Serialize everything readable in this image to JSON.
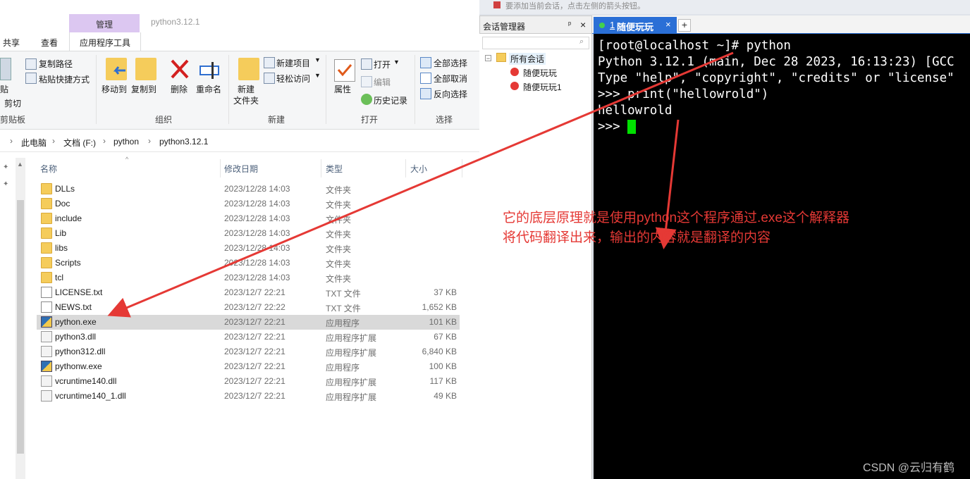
{
  "explorer": {
    "ribbon_tabs": {
      "share": "共享",
      "view": "查看",
      "ctx_group": "管理",
      "ctx_tab": "应用程序工具",
      "window_title": "python3.12.1"
    },
    "clipboard": {
      "paste": "贴",
      "cut": "剪切",
      "copy_path": "复制路径",
      "paste_shortcut": "粘贴快捷方式",
      "label": "剪贴板"
    },
    "organize": {
      "move_to": "移动到",
      "copy_to": "复制到",
      "delete": "删除",
      "rename": "重命名",
      "label": "组织"
    },
    "new": {
      "new_folder_1": "新建",
      "new_folder_2": "文件夹",
      "new_item": "新建项目",
      "easy_access": "轻松访问",
      "label": "新建"
    },
    "open": {
      "properties": "属性",
      "open": "打开",
      "edit": "编辑",
      "history": "历史记录",
      "label": "打开"
    },
    "select": {
      "select_all": "全部选择",
      "select_none": "全部取消",
      "invert": "反向选择",
      "label": "选择"
    },
    "breadcrumb": [
      "此电脑",
      "文档 (F:)",
      "python",
      "python3.12.1"
    ],
    "columns": {
      "name": "名称",
      "date": "修改日期",
      "type": "类型",
      "size": "大小"
    },
    "files": [
      {
        "name": "DLLs",
        "date": "2023/12/28 14:03",
        "type": "文件夹",
        "size": "",
        "icon": "folder"
      },
      {
        "name": "Doc",
        "date": "2023/12/28 14:03",
        "type": "文件夹",
        "size": "",
        "icon": "folder"
      },
      {
        "name": "include",
        "date": "2023/12/28 14:03",
        "type": "文件夹",
        "size": "",
        "icon": "folder"
      },
      {
        "name": "Lib",
        "date": "2023/12/28 14:03",
        "type": "文件夹",
        "size": "",
        "icon": "folder"
      },
      {
        "name": "libs",
        "date": "2023/12/28 14:03",
        "type": "文件夹",
        "size": "",
        "icon": "folder"
      },
      {
        "name": "Scripts",
        "date": "2023/12/28 14:03",
        "type": "文件夹",
        "size": "",
        "icon": "folder"
      },
      {
        "name": "tcl",
        "date": "2023/12/28 14:03",
        "type": "文件夹",
        "size": "",
        "icon": "folder"
      },
      {
        "name": "LICENSE.txt",
        "date": "2023/12/7 22:21",
        "type": "TXT 文件",
        "size": "37 KB",
        "icon": "txt"
      },
      {
        "name": "NEWS.txt",
        "date": "2023/12/7 22:22",
        "type": "TXT 文件",
        "size": "1,652 KB",
        "icon": "txt"
      },
      {
        "name": "python.exe",
        "date": "2023/12/7 22:21",
        "type": "应用程序",
        "size": "101 KB",
        "icon": "exe",
        "selected": true
      },
      {
        "name": "python3.dll",
        "date": "2023/12/7 22:21",
        "type": "应用程序扩展",
        "size": "67 KB",
        "icon": "dll"
      },
      {
        "name": "python312.dll",
        "date": "2023/12/7 22:21",
        "type": "应用程序扩展",
        "size": "6,840 KB",
        "icon": "dll"
      },
      {
        "name": "pythonw.exe",
        "date": "2023/12/7 22:21",
        "type": "应用程序",
        "size": "100 KB",
        "icon": "exe"
      },
      {
        "name": "vcruntime140.dll",
        "date": "2023/12/7 22:21",
        "type": "应用程序扩展",
        "size": "117 KB",
        "icon": "dll"
      },
      {
        "name": "vcruntime140_1.dll",
        "date": "2023/12/7 22:21",
        "type": "应用程序扩展",
        "size": "49 KB",
        "icon": "dll"
      }
    ]
  },
  "xshell": {
    "top_hint": "要添加当前会话，点击左侧的箭头按钮。",
    "session_manager": {
      "title": "会话管理器",
      "pin": "ᵖ",
      "close": "×",
      "root": "所有会话",
      "items": [
        "随便玩玩",
        "随便玩玩1"
      ]
    },
    "tab": {
      "index": "1",
      "label": "随便玩玩",
      "close": "×",
      "plus": "+"
    },
    "terminal_lines": [
      "[root@localhost ~]# python",
      "Python 3.12.1 (main, Dec 28 2023, 16:13:23) [GCC",
      "Type \"help\", \"copyright\", \"credits\" or \"license\"",
      ">>> print(\"hellowrold\")",
      "hellowrold",
      ">>> "
    ]
  },
  "annotation": {
    "line1": "它的底层原理就是使用python这个程序通过.exe这个解释器",
    "line2": "将代码翻译出来，输出的内容就是翻译的内容",
    "color": "#e53935"
  },
  "watermark": "CSDN @云归有鹤"
}
